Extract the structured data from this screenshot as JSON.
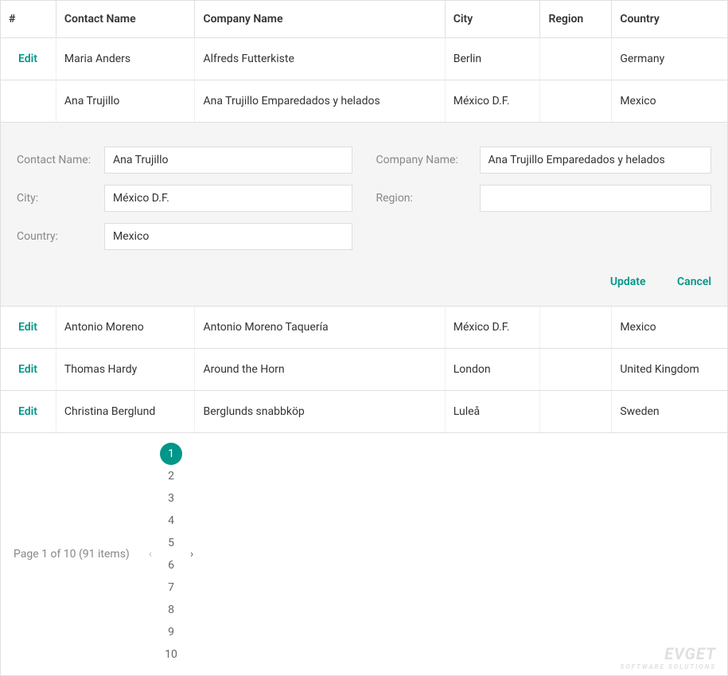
{
  "columns": {
    "action": "#",
    "contact": "Contact Name",
    "company": "Company Name",
    "city": "City",
    "region": "Region",
    "country": "Country"
  },
  "edit_label": "Edit",
  "rows_top": [
    {
      "contact": "Maria Anders",
      "company": "Alfreds Futterkiste",
      "city": "Berlin",
      "region": "",
      "country": "Germany",
      "show_edit": true
    },
    {
      "contact": "Ana Trujillo",
      "company": "Ana Trujillo Emparedados y helados",
      "city": "México D.F.",
      "region": "",
      "country": "Mexico",
      "show_edit": false
    }
  ],
  "rows_bottom": [
    {
      "contact": "Antonio Moreno",
      "company": "Antonio Moreno Taquería",
      "city": "México D.F.",
      "region": "",
      "country": "Mexico",
      "show_edit": true
    },
    {
      "contact": "Thomas Hardy",
      "company": "Around the Horn",
      "city": "London",
      "region": "",
      "country": "United Kingdom",
      "show_edit": true
    },
    {
      "contact": "Christina Berglund",
      "company": "Berglunds snabbköp",
      "city": "Luleå",
      "region": "",
      "country": "Sweden",
      "show_edit": true
    }
  ],
  "edit_form": {
    "labels": {
      "contact": "Contact Name:",
      "company": "Company Name:",
      "city": "City:",
      "region": "Region:",
      "country": "Country:"
    },
    "values": {
      "contact": "Ana Trujillo",
      "company": "Ana Trujillo Emparedados y helados",
      "city": "México D.F.",
      "region": "",
      "country": "Mexico"
    },
    "buttons": {
      "update": "Update",
      "cancel": "Cancel"
    }
  },
  "pager": {
    "info": "Page 1 of 10 (91 items)",
    "pages": [
      "1",
      "2",
      "3",
      "4",
      "5",
      "6",
      "7",
      "8",
      "9",
      "10"
    ],
    "active_index": 0
  },
  "watermark": {
    "line1": "EVGET",
    "line2": "SOFTWARE SOLUTIONS"
  }
}
